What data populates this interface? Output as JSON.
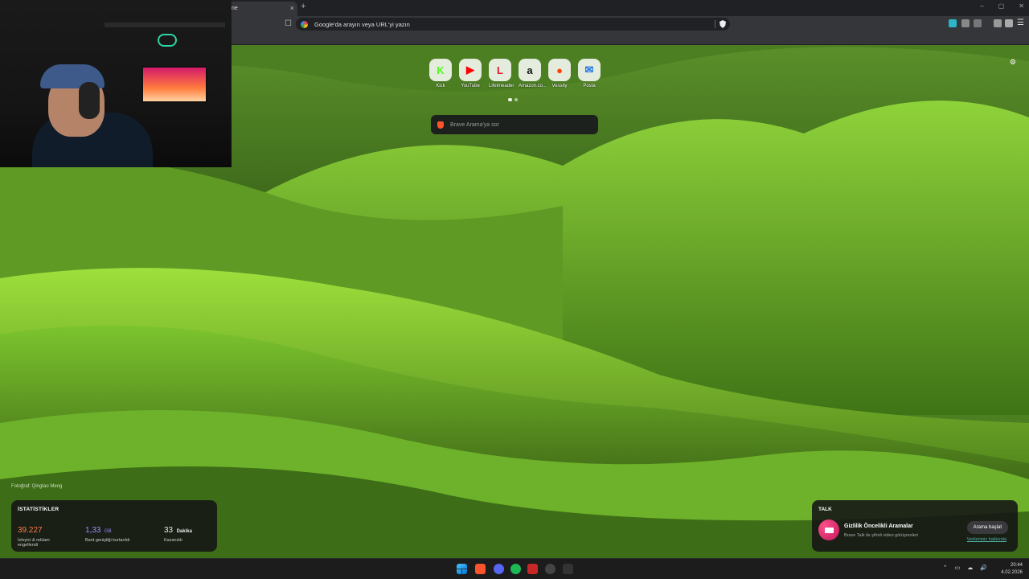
{
  "browser": {
    "tab_title": "ne",
    "tab_close": "×",
    "new_tab": "+",
    "window_controls": [
      "–",
      "▢",
      "✕"
    ],
    "address_placeholder": "Google'da arayın veya URL'yi yazın",
    "menu": "☰"
  },
  "new_tab_page": {
    "top_sites": [
      {
        "label": "Kick",
        "glyph": "K",
        "color": "#53fc18"
      },
      {
        "label": "YouTube",
        "glyph": "▶",
        "color": "#ff0000"
      },
      {
        "label": "Lifelmeader",
        "glyph": "L",
        "color": "#e11d2e"
      },
      {
        "label": "Amazon.co...",
        "glyph": "a",
        "color": "#111111"
      },
      {
        "label": "Vessity",
        "glyph": "●",
        "color": "#ff4500"
      },
      {
        "label": "Posta",
        "glyph": "✉",
        "color": "#1a73e8"
      }
    ],
    "search_placeholder": "Brave Arama'ya sor",
    "settings_icon": "⚙",
    "photo_credit": "Fotoğraf: Qingtao Meng"
  },
  "stats": {
    "heading": "İSTATİSTİKLER",
    "items": [
      {
        "value": "39.227",
        "unit": "",
        "label": "İzleyici & reklam engellendi",
        "color": "#ff7a45"
      },
      {
        "value": "1,33",
        "unit": "GB",
        "label": "Bant genişliği kurtarıldı",
        "color": "#9b8cff"
      },
      {
        "value": "33",
        "unit": "Dakika",
        "label": "Kazanıldı",
        "color": "#ffffff"
      }
    ]
  },
  "talk": {
    "heading": "TALK",
    "title": "Gizlilik Öncelikli Aramalar",
    "subtitle": "Brave Talk ile şifreli video görüşmeleri",
    "start_button": "Arama başlat",
    "privacy_link": "Verilerimiz hakkında"
  },
  "taskbar": {
    "time": "20:44",
    "date": "4.02.2026",
    "tray_icons": [
      "⌃",
      "▭",
      "☁",
      "🔊"
    ]
  }
}
